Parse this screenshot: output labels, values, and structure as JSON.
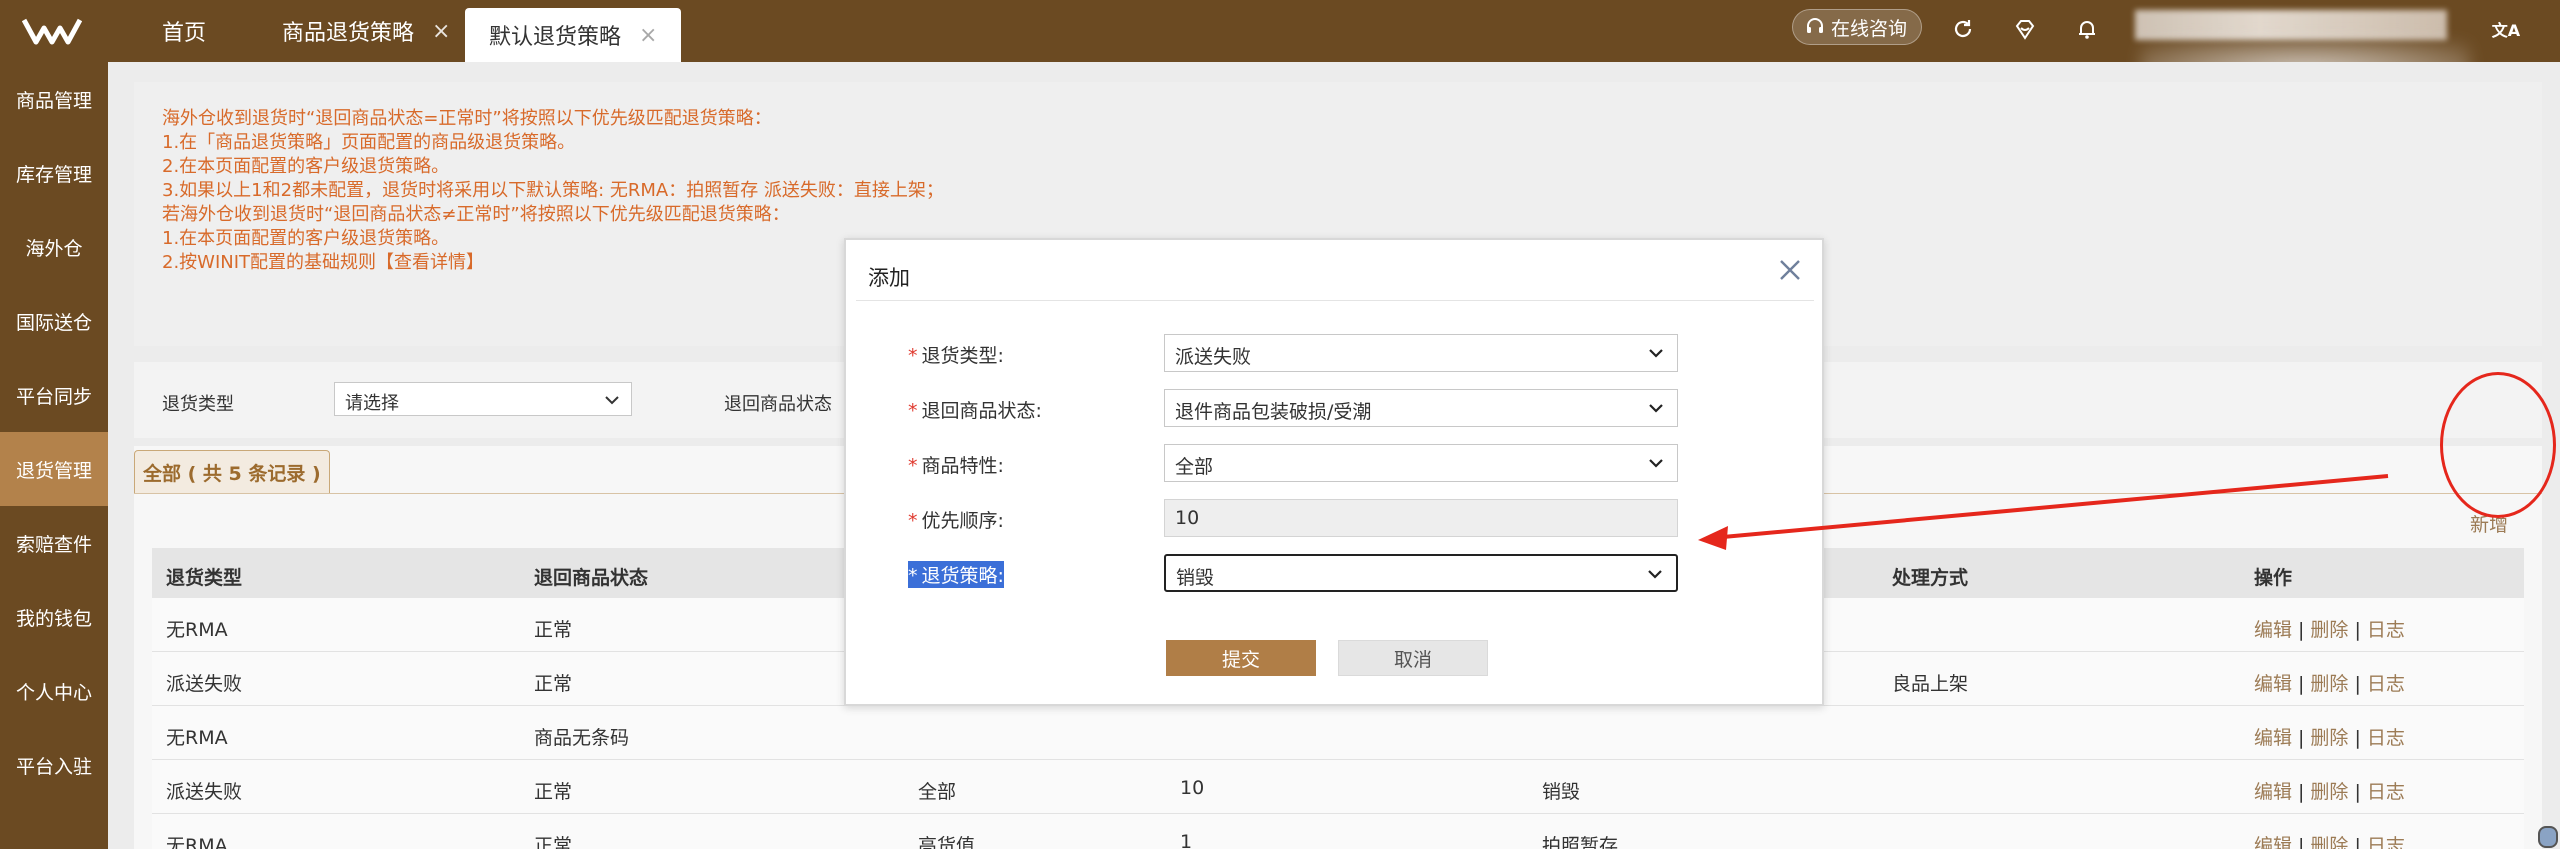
{
  "topbar": {
    "tabs": [
      {
        "label": "首页",
        "closable": false
      },
      {
        "label": "商品退货策略",
        "closable": true
      },
      {
        "label": "默认退货策略",
        "closable": true,
        "active": true
      }
    ],
    "close_glyph": "×",
    "consult_label": "在线咨询",
    "icons": [
      "refresh-icon",
      "smile-icon",
      "bell-icon",
      "translate-icon"
    ],
    "translate_glyph": "文A"
  },
  "sidebar": {
    "items": [
      {
        "label": "商品管理"
      },
      {
        "label": "库存管理"
      },
      {
        "label": "海外仓"
      },
      {
        "label": "国际送仓"
      },
      {
        "label": "平台同步"
      },
      {
        "label": "退货管理",
        "active": true
      },
      {
        "label": "索赔查件"
      },
      {
        "label": "我的钱包"
      },
      {
        "label": "个人中心"
      },
      {
        "label": "平台入驻"
      }
    ]
  },
  "notice": {
    "lines": [
      "海外仓收到退货时“退回商品状态=正常时”将按照以下优先级匹配退货策略：",
      "1.在「商品退货策略」页面配置的商品级退货策略。",
      "2.在本页面配置的客户级退货策略。",
      "3.如果以上1和2都未配置，退货时将采用以下默认策略: 无RMA：拍照暂存 派送失败：直接上架；",
      "若海外仓收到退货时“退回商品状态≠正常时”将按照以下优先级匹配退货策略：",
      "1.在本页面配置的客户级退货策略。",
      "2.按WINIT配置的基础规则【查看详情】"
    ]
  },
  "filter": {
    "return_type_label": "退货类型",
    "return_type_value": "请选择",
    "return_status_label": "退回商品状态"
  },
  "list": {
    "tab_label": "全部 ( 共 5 条记录 )",
    "add_label": "新增",
    "columns": [
      "退货类型",
      "退回商品状态",
      "",
      "",
      "",
      "处理方式",
      "操作"
    ],
    "rows": [
      {
        "type": "无RMA",
        "status": "正常",
        "feature": "",
        "priority": "",
        "strategy": "",
        "method": ""
      },
      {
        "type": "派送失败",
        "status": "正常",
        "feature": "",
        "priority": "",
        "strategy": "",
        "method": "良品上架"
      },
      {
        "type": "无RMA",
        "status": "商品无条码",
        "feature": "",
        "priority": "",
        "strategy": "",
        "method": ""
      },
      {
        "type": "派送失败",
        "status": "正常",
        "feature": "全部",
        "priority": "10",
        "strategy": "销毁",
        "method": ""
      },
      {
        "type": "无RMA",
        "status": "正常",
        "feature": "高货值",
        "priority": "1",
        "strategy": "拍照暂存",
        "method": ""
      }
    ],
    "ops": {
      "edit": "编辑",
      "delete": "删除",
      "log": "日志",
      "sep": "|"
    }
  },
  "modal": {
    "title": "添加",
    "required_mark": "*",
    "fields": [
      {
        "label": "退货类型:",
        "value": "派送失败"
      },
      {
        "label": "退回商品状态:",
        "value": "退件商品包装破损/受潮"
      },
      {
        "label": "商品特性:",
        "value": "全部"
      },
      {
        "label": "优先顺序:",
        "value": "10"
      },
      {
        "label": "退货策略:",
        "value": "销毁"
      }
    ],
    "submit_label": "提交",
    "cancel_label": "取消"
  },
  "colors": {
    "brand_brown": "#6b4a22",
    "accent": "#b07e47",
    "notice_orange": "#d86a2a",
    "annotation_red": "#e5271c"
  }
}
